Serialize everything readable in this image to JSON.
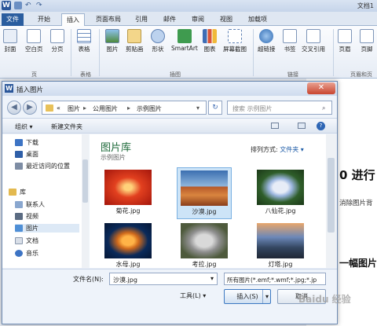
{
  "window": {
    "doc_title": "文档1"
  },
  "ribbon": {
    "tabs": [
      "文件",
      "开始",
      "插入",
      "页面布局",
      "引用",
      "邮件",
      "审阅",
      "视图",
      "加载项"
    ],
    "buttons": [
      "封面",
      "空白页",
      "分页",
      "表格",
      "图片",
      "剪贴画",
      "形状",
      "SmartArt",
      "图表",
      "屏幕截图",
      "超链接",
      "书签",
      "交叉引用",
      "页眉",
      "页脚"
    ],
    "groups": [
      "页",
      "表格",
      "插图",
      "链接",
      "页眉和页"
    ]
  },
  "dialog": {
    "title": "插入图片",
    "address": {
      "root": "«",
      "parts": [
        "图片",
        "公用图片",
        "示例图片"
      ]
    },
    "search_placeholder": "搜索 示例图片",
    "toolbar": {
      "organize": "组织 ▾",
      "new_folder": "新建文件夹"
    },
    "nav_items": [
      "下载",
      "桌面",
      "最近访问的位置",
      "库",
      "联系人",
      "视频",
      "图片",
      "文档",
      "音乐"
    ],
    "library_title": "图片库",
    "library_subtitle": "示例图片",
    "arrange_label": "排列方式:",
    "arrange_value": "文件夹 ▾",
    "files": [
      "菊花.jpg",
      "沙漠.jpg",
      "八仙花.jpg",
      "水母.jpg",
      "考拉.jpg",
      "灯塔.jpg"
    ],
    "filename_label": "文件名(N):",
    "filename_value": "沙漠.jpg",
    "filter_value": "所有图片(*.emf;*.wmf;*.jpg;*.jp",
    "tools_label": "工具(L)",
    "insert_label": "插入(S)",
    "cancel_label": "取消"
  },
  "document": {
    "heading": "0 进行",
    "line1": "消除图片背",
    "line2": "一幅图片"
  },
  "colors": {
    "file_tab": "#2a5d9f",
    "library_title": "#1e6a3a",
    "selection": "#cde4f7"
  }
}
